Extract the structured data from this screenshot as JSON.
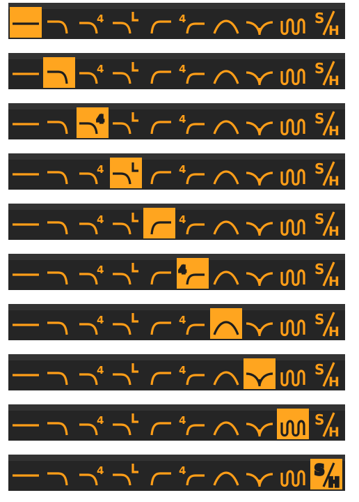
{
  "colors": {
    "background": "#252525",
    "background_top": "#333333",
    "accent": "#ff9e18",
    "selected_background": "#ffa51f",
    "selected_icon": "#1e1e1e"
  },
  "filter_types": [
    {
      "id": "flat",
      "icon": "flat-line-icon"
    },
    {
      "id": "low-pass",
      "icon": "low-pass-curve-icon"
    },
    {
      "id": "low-pass-4",
      "icon": "low-pass-4-pole-icon",
      "label": "4"
    },
    {
      "id": "low-pass-l",
      "icon": "low-pass-l-icon",
      "label": "L"
    },
    {
      "id": "high-pass",
      "icon": "high-pass-curve-icon"
    },
    {
      "id": "high-pass-4",
      "icon": "high-pass-4-pole-icon",
      "label": "4"
    },
    {
      "id": "band-pass",
      "icon": "band-pass-arch-icon"
    },
    {
      "id": "notch",
      "icon": "notch-y-icon"
    },
    {
      "id": "comb",
      "icon": "comb-wave-icon"
    },
    {
      "id": "sample-hold",
      "icon": "sample-hold-icon",
      "label_top": "S",
      "label_bottom": "H"
    }
  ],
  "strips": [
    {
      "selected": 0
    },
    {
      "selected": 1
    },
    {
      "selected": 2
    },
    {
      "selected": 3
    },
    {
      "selected": 4
    },
    {
      "selected": 5
    },
    {
      "selected": 6
    },
    {
      "selected": 7
    },
    {
      "selected": 8
    },
    {
      "selected": 9
    }
  ]
}
